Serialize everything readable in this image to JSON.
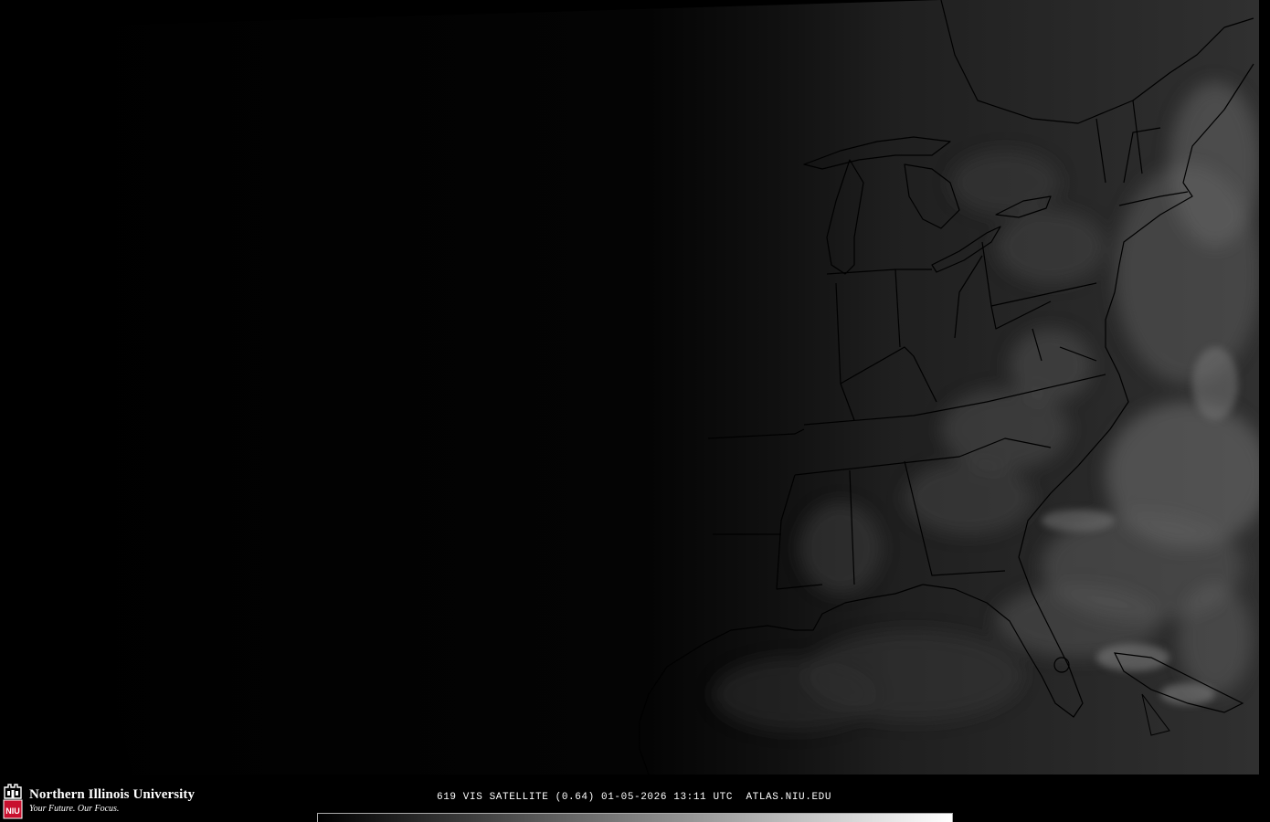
{
  "map": {
    "type": "satellite-visible",
    "region": "eastern-united-states",
    "features": [
      "state-boundaries",
      "great-lakes",
      "atlantic-coast",
      "gulf-coast",
      "florida-peninsula",
      "cloud-cover"
    ]
  },
  "footer": {
    "logo": {
      "icon": "niu-logo-icon",
      "mark_text": "NIU",
      "name": "Northern Illinois University",
      "tagline": "Your Future. Our Focus."
    },
    "caption": "619 VIS SATELLITE (0.64) 01-05-2026 13:11 UTC  ATLAS.NIU.EDU",
    "colorbar": {
      "colors": [
        "#000000",
        "#ffffff"
      ]
    }
  },
  "colors": {
    "background": "#000000",
    "logo_red": "#c8102e",
    "text": "#ffffff",
    "borders": "#000000"
  }
}
